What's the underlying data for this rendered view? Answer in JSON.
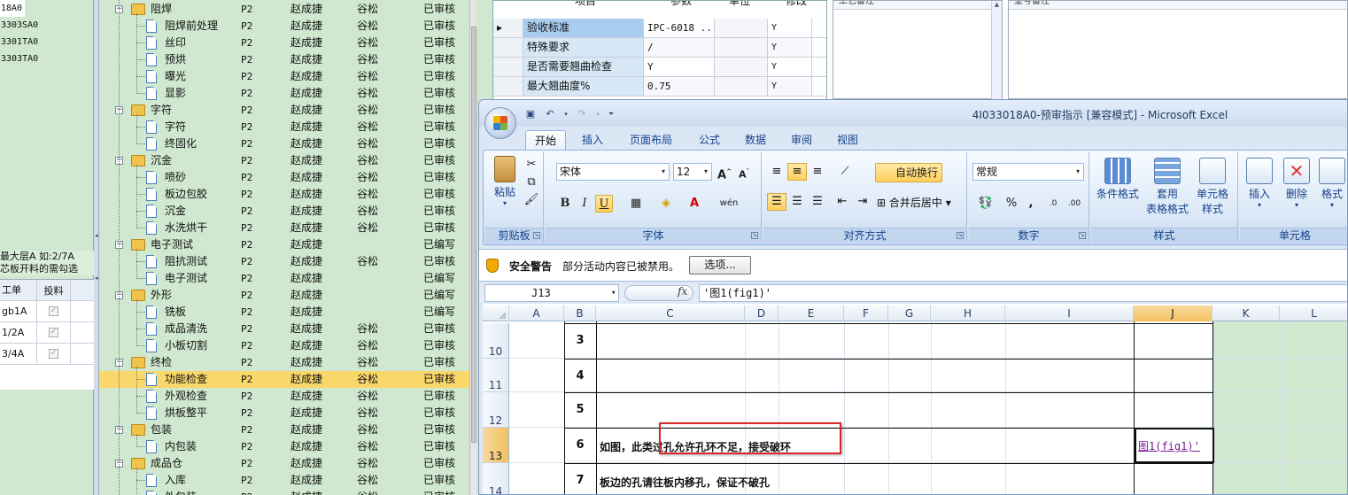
{
  "left_panel": {
    "ids": [
      "18A0",
      "3303SA0",
      "3301TA0",
      "3303TA0"
    ],
    "note": [
      "最大层A 如:2/7A",
      "芯板开料的需勾选"
    ],
    "grid_headers": [
      "工单",
      "投料"
    ],
    "grid_rows": [
      "gb1A",
      "1/2A",
      "3/4A"
    ]
  },
  "tree": [
    {
      "level": 0,
      "name": "阻焊",
      "p": "P2",
      "a": "赵成捷",
      "b": "谷松",
      "s": "已审核",
      "folder": true
    },
    {
      "level": 1,
      "name": "阻焊前处理",
      "p": "P2",
      "a": "赵成捷",
      "b": "谷松",
      "s": "已审核"
    },
    {
      "level": 1,
      "name": "丝印",
      "p": "P2",
      "a": "赵成捷",
      "b": "谷松",
      "s": "已审核"
    },
    {
      "level": 1,
      "name": "预烘",
      "p": "P2",
      "a": "赵成捷",
      "b": "谷松",
      "s": "已审核"
    },
    {
      "level": 1,
      "name": "曝光",
      "p": "P2",
      "a": "赵成捷",
      "b": "谷松",
      "s": "已审核"
    },
    {
      "level": 1,
      "name": "显影",
      "p": "P2",
      "a": "赵成捷",
      "b": "谷松",
      "s": "已审核"
    },
    {
      "level": 0,
      "name": "字符",
      "p": "P2",
      "a": "赵成捷",
      "b": "谷松",
      "s": "已审核",
      "folder": true
    },
    {
      "level": 1,
      "name": "字符",
      "p": "P2",
      "a": "赵成捷",
      "b": "谷松",
      "s": "已审核"
    },
    {
      "level": 1,
      "name": "终固化",
      "p": "P2",
      "a": "赵成捷",
      "b": "谷松",
      "s": "已审核"
    },
    {
      "level": 0,
      "name": "沉金",
      "p": "P2",
      "a": "赵成捷",
      "b": "谷松",
      "s": "已审核",
      "folder": true
    },
    {
      "level": 1,
      "name": "喷砂",
      "p": "P2",
      "a": "赵成捷",
      "b": "谷松",
      "s": "已审核"
    },
    {
      "level": 1,
      "name": "板边包胶",
      "p": "P2",
      "a": "赵成捷",
      "b": "谷松",
      "s": "已审核"
    },
    {
      "level": 1,
      "name": "沉金",
      "p": "P2",
      "a": "赵成捷",
      "b": "谷松",
      "s": "已审核"
    },
    {
      "level": 1,
      "name": "水洗烘干",
      "p": "P2",
      "a": "赵成捷",
      "b": "谷松",
      "s": "已审核"
    },
    {
      "level": 0,
      "name": "电子测试",
      "p": "P2",
      "a": "赵成捷",
      "b": "",
      "s": "已编写",
      "folder": true
    },
    {
      "level": 1,
      "name": "阻抗测试",
      "p": "P2",
      "a": "赵成捷",
      "b": "谷松",
      "s": "已审核"
    },
    {
      "level": 1,
      "name": "电子测试",
      "p": "P2",
      "a": "赵成捷",
      "b": "",
      "s": "已编写"
    },
    {
      "level": 0,
      "name": "外形",
      "p": "P2",
      "a": "赵成捷",
      "b": "",
      "s": "已编写",
      "folder": true
    },
    {
      "level": 1,
      "name": "铣板",
      "p": "P2",
      "a": "赵成捷",
      "b": "",
      "s": "已编写"
    },
    {
      "level": 1,
      "name": "成品清洗",
      "p": "P2",
      "a": "赵成捷",
      "b": "谷松",
      "s": "已审核"
    },
    {
      "level": 1,
      "name": "小板切割",
      "p": "P2",
      "a": "赵成捷",
      "b": "谷松",
      "s": "已审核"
    },
    {
      "level": 0,
      "name": "终检",
      "p": "P2",
      "a": "赵成捷",
      "b": "谷松",
      "s": "已审核",
      "folder": true
    },
    {
      "level": 1,
      "name": "功能检查",
      "p": "P2",
      "a": "赵成捷",
      "b": "谷松",
      "s": "已审核",
      "selected": true
    },
    {
      "level": 1,
      "name": "外观检查",
      "p": "P2",
      "a": "赵成捷",
      "b": "谷松",
      "s": "已审核"
    },
    {
      "level": 1,
      "name": "烘板整平",
      "p": "P2",
      "a": "赵成捷",
      "b": "谷松",
      "s": "已审核"
    },
    {
      "level": 0,
      "name": "包装",
      "p": "P2",
      "a": "赵成捷",
      "b": "谷松",
      "s": "已审核",
      "folder": true
    },
    {
      "level": 1,
      "name": "内包装",
      "p": "P2",
      "a": "赵成捷",
      "b": "谷松",
      "s": "已审核"
    },
    {
      "level": 0,
      "name": "成品仓",
      "p": "P2",
      "a": "赵成捷",
      "b": "谷松",
      "s": "已审核",
      "folder": true
    },
    {
      "level": 1,
      "name": "入库",
      "p": "P2",
      "a": "赵成捷",
      "b": "谷松",
      "s": "已审核"
    },
    {
      "level": 1,
      "name": "外包装",
      "p": "P2",
      "a": "赵成捷",
      "b": "谷松",
      "s": "已审核"
    }
  ],
  "params": {
    "headers": {
      "item": "项目",
      "param": "参数",
      "unit": "单位",
      "modify": "修改"
    },
    "rows": [
      {
        "name": "验收标准",
        "value": "IPC-6018 ...",
        "unit": "",
        "mod": "Y",
        "selected": true
      },
      {
        "name": "特殊要求",
        "value": "/",
        "unit": "",
        "mod": "Y"
      },
      {
        "name": "是否需要翘曲检查",
        "value": "Y",
        "unit": "",
        "mod": "Y"
      },
      {
        "name": "最大翘曲度%",
        "value": "0.75",
        "unit": "",
        "mod": "Y"
      }
    ]
  },
  "right_panels": {
    "a_title": "工艺备注",
    "b_title": "型号备注"
  },
  "excel": {
    "caption": "4I033018A0-预审指示 [兼容模式] - Microsoft Excel",
    "tabs": [
      "开始",
      "插入",
      "页面布局",
      "公式",
      "数据",
      "审阅",
      "视图"
    ],
    "clipboard": {
      "paste": "粘贴",
      "label": "剪贴板"
    },
    "font": {
      "name": "宋体",
      "size": "12",
      "label": "字体",
      "bold": "B",
      "italic": "I",
      "underline": "U",
      "phonetic": "wén"
    },
    "alignment": {
      "wrap": "自动换行",
      "merge": "合并后居中",
      "label": "对齐方式"
    },
    "number": {
      "format": "常规",
      "label": "数字"
    },
    "styles": {
      "cond": "条件格式",
      "table1": "套用",
      "table2": "表格格式",
      "cell1": "单元格",
      "cell2": "样式",
      "label": "样式"
    },
    "cells": {
      "insert": "插入",
      "delete": "删除",
      "format": "格式",
      "label": "单元格"
    },
    "security": {
      "title": "安全警告",
      "message": "部分活动内容已被禁用。",
      "button": "选项..."
    },
    "namebox": "J13",
    "formula": "'图1(fig1)'",
    "columns": [
      "A",
      "B",
      "C",
      "D",
      "E",
      "F",
      "G",
      "H",
      "I",
      "J",
      "K",
      "L"
    ],
    "active_col": "J",
    "rows": [
      {
        "row": "10",
        "num": "3",
        "text": ""
      },
      {
        "row": "11",
        "num": "4",
        "text": ""
      },
      {
        "row": "12",
        "num": "5",
        "text": ""
      },
      {
        "row": "13",
        "num": "6",
        "text": "如图，此类过孔允许孔环不足，接受破环",
        "link": "图1(fig1)'",
        "active": true
      },
      {
        "row": "14",
        "num": "7",
        "text": "板边的孔请往板内移孔，保证不破孔"
      }
    ]
  }
}
